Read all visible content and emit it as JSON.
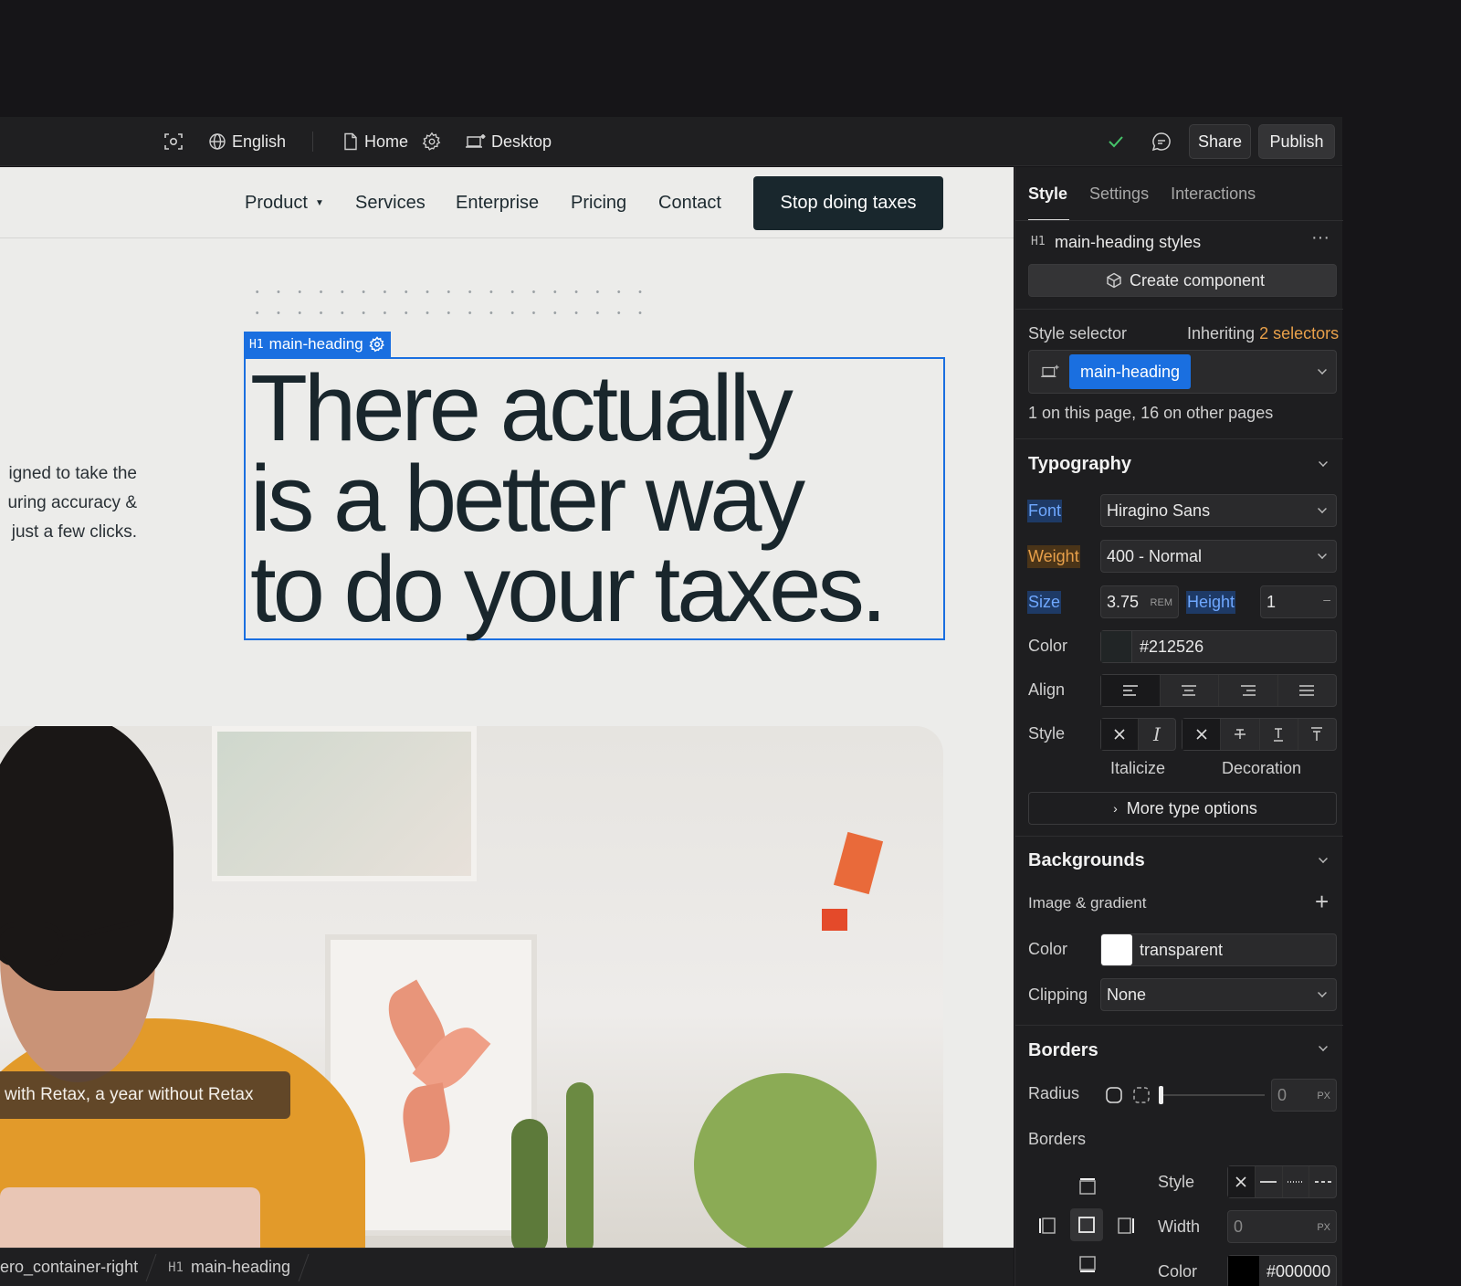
{
  "topbar": {
    "language": "English",
    "page": "Home",
    "breakpoint": "Desktop",
    "share": "Share",
    "publish": "Publish"
  },
  "site": {
    "nav": [
      "Product",
      "Services",
      "Enterprise",
      "Pricing",
      "Contact"
    ],
    "cta": "Stop doing taxes",
    "selection_tag_type": "H1",
    "selection_tag_name": "main-heading",
    "heading_lines": [
      "There actually",
      "is a better way",
      "to do your taxes."
    ],
    "side_text_lines": [
      "igned to take the",
      "uring accuracy &",
      "just a few clicks."
    ],
    "photo_caption": "with Retax, a year without Retax"
  },
  "breadcrumb": {
    "item1": "ero_container-right",
    "item2_type": "H1",
    "item2": "main-heading"
  },
  "panel": {
    "tabs": [
      "Style",
      "Settings",
      "Interactions"
    ],
    "element_type": "H1",
    "element_styles": "main-heading styles",
    "more": "···",
    "create_component": "Create component",
    "style_selector_label": "Style selector",
    "inheriting_prefix": "Inheriting",
    "inheriting_count": "2 selectors",
    "selector_chip": "main-heading",
    "usage": "1 on this page, 16 on other pages",
    "typography": {
      "title": "Typography",
      "font_label": "Font",
      "font_value": "Hiragino Sans",
      "weight_label": "Weight",
      "weight_value": "400 - Normal",
      "size_label": "Size",
      "size_value": "3.75",
      "size_unit": "REM",
      "height_label": "Height",
      "height_value": "1",
      "height_unit": "–",
      "color_label": "Color",
      "color_value": "#212526",
      "align_label": "Align",
      "style_label": "Style",
      "italicize_label": "Italicize",
      "decoration_label": "Decoration",
      "more_options": "More type options"
    },
    "backgrounds": {
      "title": "Backgrounds",
      "image_gradient": "Image & gradient",
      "color_label": "Color",
      "color_value": "transparent",
      "clipping_label": "Clipping",
      "clipping_value": "None"
    },
    "borders": {
      "title": "Borders",
      "radius_label": "Radius",
      "radius_value": "0",
      "radius_unit": "PX",
      "borders_label": "Borders",
      "style_label": "Style",
      "width_label": "Width",
      "width_value": "0",
      "width_unit": "PX",
      "color_label": "Color",
      "color_value": "#000000"
    }
  },
  "colors": {
    "accent_blue": "#1a6fe0",
    "heading_text": "#19262c",
    "weight_orange": "#e8a04a",
    "check_green": "#45c46a"
  }
}
